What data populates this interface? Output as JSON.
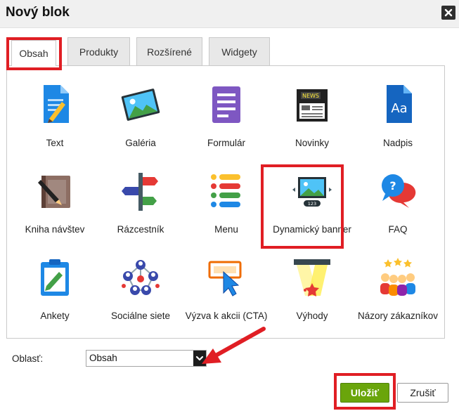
{
  "dialog": {
    "title": "Nový blok"
  },
  "tabs": [
    {
      "label": "Obsah",
      "active": true
    },
    {
      "label": "Produkty",
      "active": false
    },
    {
      "label": "Rozšírené",
      "active": false
    },
    {
      "label": "Widgety",
      "active": false
    }
  ],
  "blocks": [
    {
      "label": "Text",
      "icon": "text-document-icon"
    },
    {
      "label": "Galéria",
      "icon": "gallery-icon"
    },
    {
      "label": "Formulár",
      "icon": "form-icon"
    },
    {
      "label": "Novinky",
      "icon": "news-icon",
      "badge": "NEWS"
    },
    {
      "label": "Nadpis",
      "icon": "heading-icon",
      "badge": "Aa"
    },
    {
      "label": "Kniha návštev",
      "icon": "guestbook-icon"
    },
    {
      "label": "Rázcestník",
      "icon": "signpost-icon"
    },
    {
      "label": "Menu",
      "icon": "menu-icon"
    },
    {
      "label": "Dynamický banner",
      "icon": "dynamic-banner-icon",
      "badge": "123"
    },
    {
      "label": "FAQ",
      "icon": "faq-icon",
      "badge": "?"
    },
    {
      "label": "Ankety",
      "icon": "poll-icon"
    },
    {
      "label": "Sociálne siete",
      "icon": "social-network-icon"
    },
    {
      "label": "Výzva k akcii (CTA)",
      "icon": "call-to-action-icon"
    },
    {
      "label": "Výhody",
      "icon": "benefits-icon"
    },
    {
      "label": "Názory zákazníkov",
      "icon": "testimonials-icon"
    }
  ],
  "area": {
    "label": "Oblasť:",
    "selected": "Obsah"
  },
  "buttons": {
    "save": "Uložiť",
    "cancel": "Zrušiť"
  },
  "colors": {
    "highlight": "#e01e24",
    "save_button": "#6aa50b"
  }
}
